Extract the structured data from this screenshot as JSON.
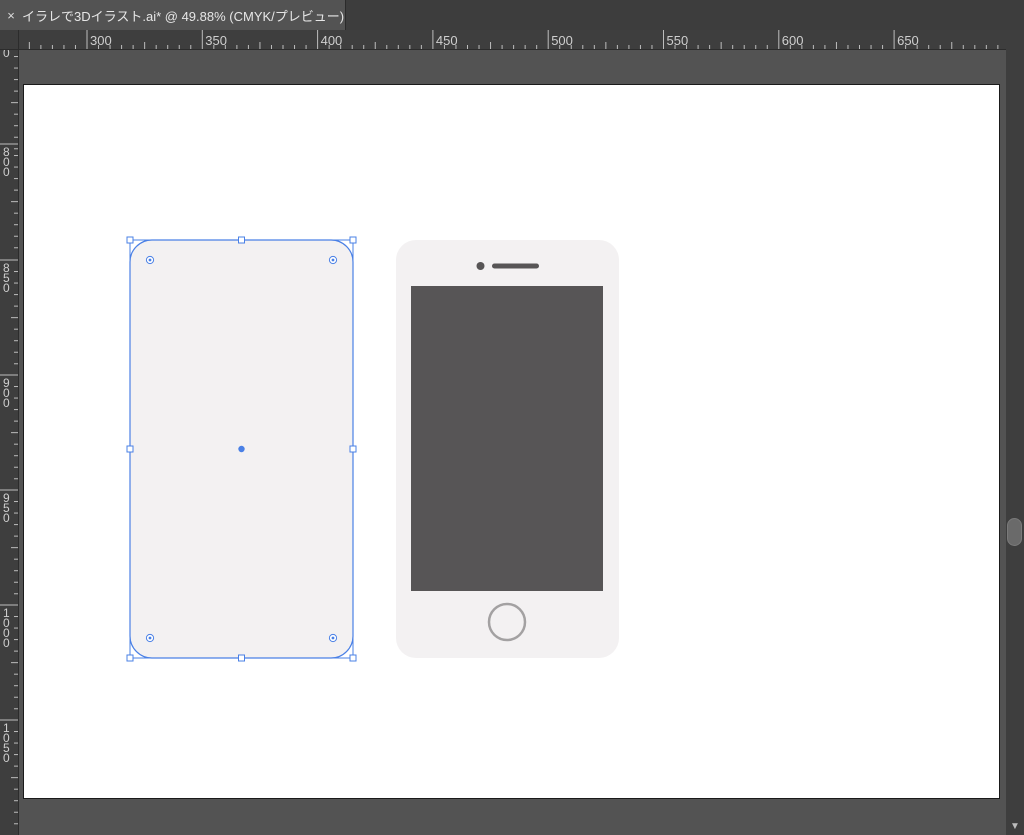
{
  "document_tab": {
    "close_symbol": "×",
    "title": "イラレで3Dイラスト.ai* @ 49.88% (CMYK/プレビュー)"
  },
  "ruler_horizontal": {
    "labels": [
      "300",
      "350",
      "400",
      "450",
      "500",
      "550",
      "600",
      "650"
    ]
  },
  "ruler_vertical": {
    "labels": [
      "0",
      "800",
      "850",
      "900",
      "950",
      "1000",
      "1050"
    ]
  },
  "colors": {
    "selection": "#4a80e6",
    "device_body": "#f3f1f2",
    "screen": "#575556",
    "artboard": "#ffffff",
    "ui_background": "#535353"
  },
  "icons": {
    "scroll_down": "chevron-down-icon",
    "tab_close": "close-icon"
  }
}
